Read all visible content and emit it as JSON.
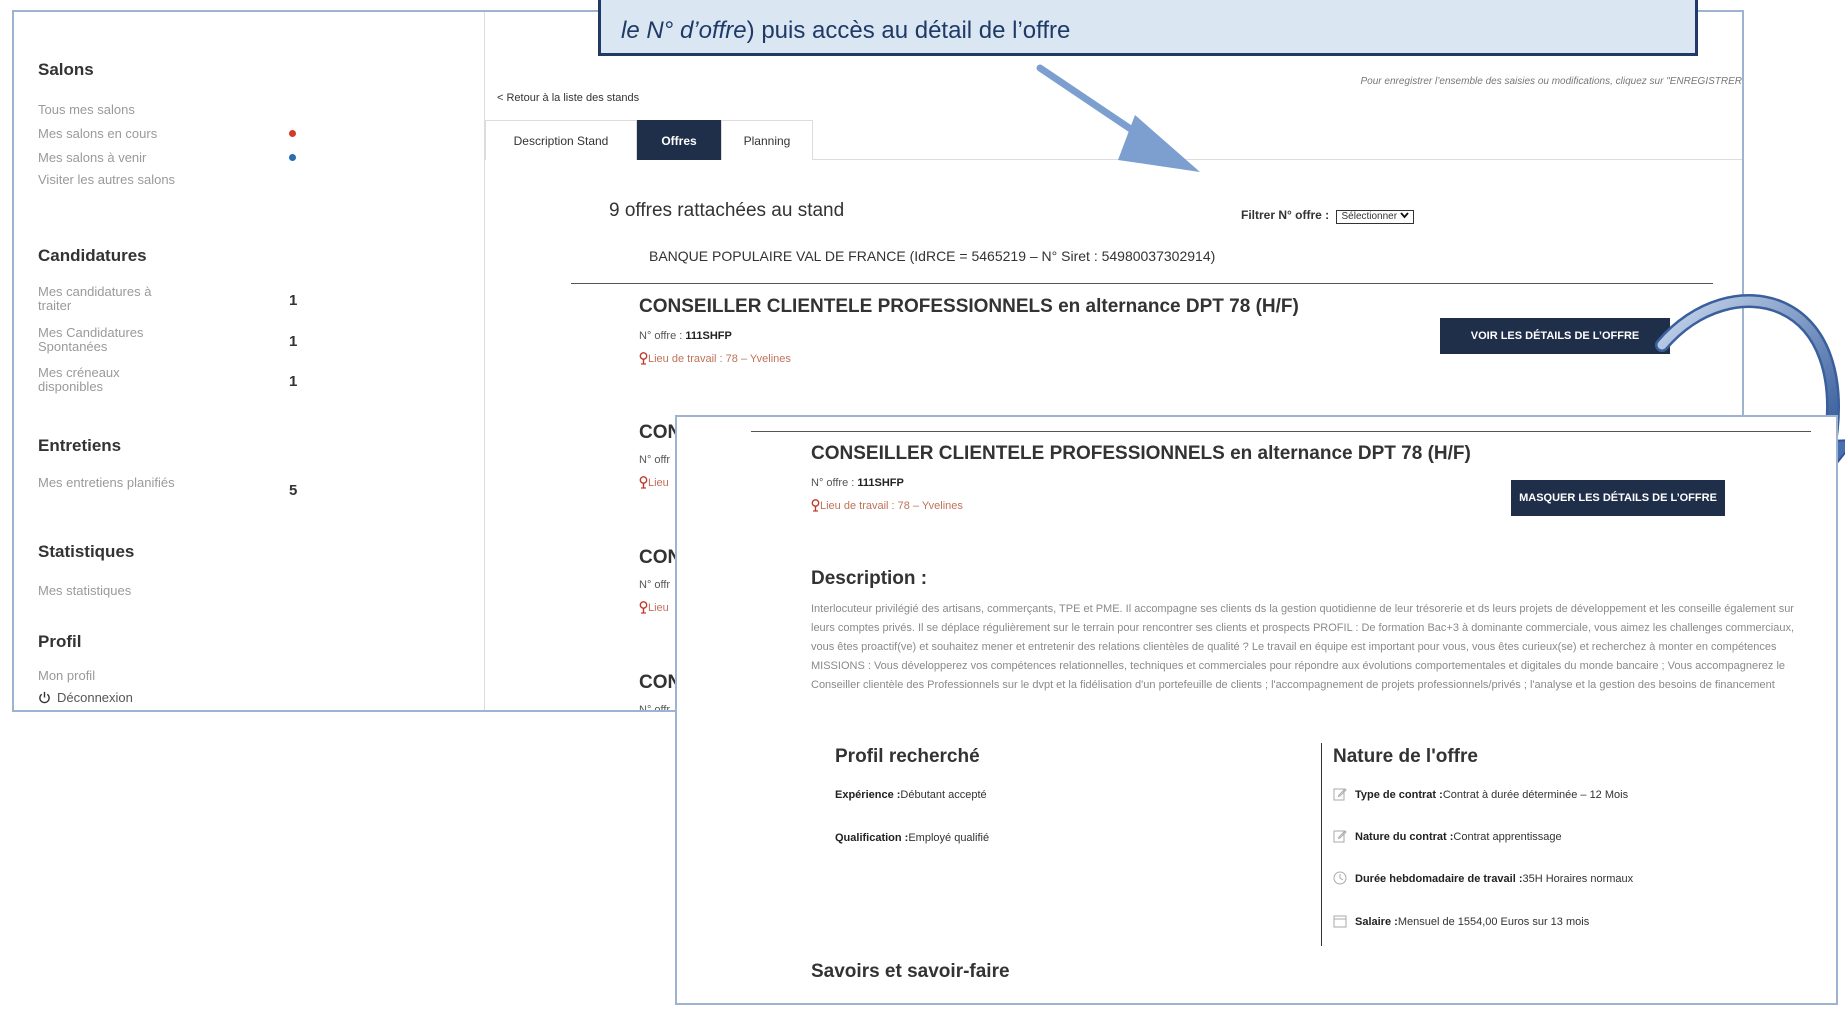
{
  "callout": {
    "line1_italic": "le N° d’offre",
    "line1_rest": ") puis accès au détail de l’offre"
  },
  "sidebar": {
    "salons": {
      "heading": "Salons",
      "items": [
        "Tous mes salons",
        "Mes salons en cours",
        "Mes salons à venir",
        "Visiter les autres salons"
      ],
      "dot_colors": {
        "en_cours": "#d63a26",
        "a_venir": "#2a6db0"
      }
    },
    "candidatures": {
      "heading": "Candidatures",
      "items": [
        {
          "label": "Mes candidatures à traiter",
          "count": "1"
        },
        {
          "label": "Mes Candidatures Spontanées",
          "count": "1"
        },
        {
          "label": "Mes créneaux disponibles",
          "count": "1"
        }
      ]
    },
    "entretiens": {
      "heading": "Entretiens",
      "items": [
        {
          "label": "Mes entretiens planifiés",
          "count": "5"
        }
      ]
    },
    "statistiques": {
      "heading": "Statistiques",
      "items": [
        "Mes statistiques"
      ]
    },
    "profil": {
      "heading": "Profil",
      "items": [
        "Mon profil"
      ],
      "logout": "Déconnexion"
    }
  },
  "main": {
    "back_link": "< Retour à la liste des stands",
    "save_note": "Pour enregistrer l’ensemble des saisies ou modifications, cliquez sur \"ENREGISTRER",
    "tabs": [
      {
        "label": "Description Stand",
        "active": false
      },
      {
        "label": "Offres",
        "active": true
      },
      {
        "label": "Planning",
        "active": false
      }
    ],
    "offers_count": "9 offres rattachées au stand",
    "filter_label": "Filtrer N° offre :",
    "filter_value": "Sélectionner",
    "company": "BANQUE POPULAIRE VAL DE FRANCE (IdRCE = 5465219 – N° Siret : 54980037302914)",
    "offer": {
      "title": "CONSEILLER CLIENTELE PROFESSIONNELS en alternance DPT 78 (H/F)",
      "num_label": "N° offre : ",
      "num_value": "111SHFP",
      "location": "Lieu de travail : 78 – Yvelines",
      "button": "VOIR LES DÉTAILS DE L’OFFRE"
    },
    "stubs": {
      "title": "CON",
      "num": "N° offr",
      "loc": "Lieu"
    }
  },
  "detail": {
    "title": "CONSEILLER CLIENTELE PROFESSIONNELS en alternance DPT 78 (H/F)",
    "num_label": "N° offre : ",
    "num_value": "111SHFP",
    "location": "Lieu de travail : 78 – Yvelines",
    "button": "MASQUER LES DÉTAILS DE L’OFFRE",
    "description_heading": "Description :",
    "description": "Interlocuteur privilégié des artisans, commerçants, TPE et PME. Il accompagne ses clients ds la gestion quotidienne de leur trésorerie et ds leurs projets de développement et les conseille également sur leurs comptes privés. Il se déplace régulièrement sur le terrain pour rencontrer ses clients et prospects PROFIL : De formation Bac+3 à dominante commerciale, vous aimez les challenges commerciaux, vous êtes proactif(ve) et souhaitez mener et entretenir des relations clientèles de qualité ? Le travail en équipe est important pour vous, vous êtes curieux(se) et recherchez à monter en compétences MISSIONS : Vous développerez vos compétences relationnelles, techniques et commerciales pour répondre aux évolutions comportementales et digitales du monde bancaire ; Vous accompagnerez le Conseiller clientèle des Professionnels sur le dvpt et la fidélisation d'un portefeuille de clients ; l'accompagnement de projets professionnels/privés ; l'analyse et la gestion des besoins de financement",
    "profil_heading": "Profil recherché",
    "experience_label": "Expérience :",
    "experience_value": "Débutant accepté",
    "qualification_label": "Qualification :",
    "qualification_value": "Employé qualifié",
    "nature_heading": "Nature de l'offre",
    "contrat_label": "Type de contrat :",
    "contrat_value": "Contrat à durée déterminée – 12 Mois",
    "nature_contrat_label": "Nature du contrat :",
    "nature_contrat_value": "Contrat apprentissage",
    "duree_label": "Durée hebdomadaire de travail :",
    "duree_value": "35H Horaires normaux",
    "salaire_label": "Salaire :",
    "salaire_value": "Mensuel de 1554,00 Euros sur 13 mois",
    "savoirs_heading": "Savoirs et savoir-faire"
  },
  "colors": {
    "dark_navy": "#1f2f4a",
    "callout_bg": "#dbe6f3",
    "callout_border": "#1f3a66",
    "arrow_blue": "#7c9fd0",
    "location": "#c0725a"
  },
  "icons": [
    "power-icon",
    "pin-icon",
    "edit-icon",
    "clock-icon",
    "calendar-icon",
    "chevron-down-icon"
  ]
}
